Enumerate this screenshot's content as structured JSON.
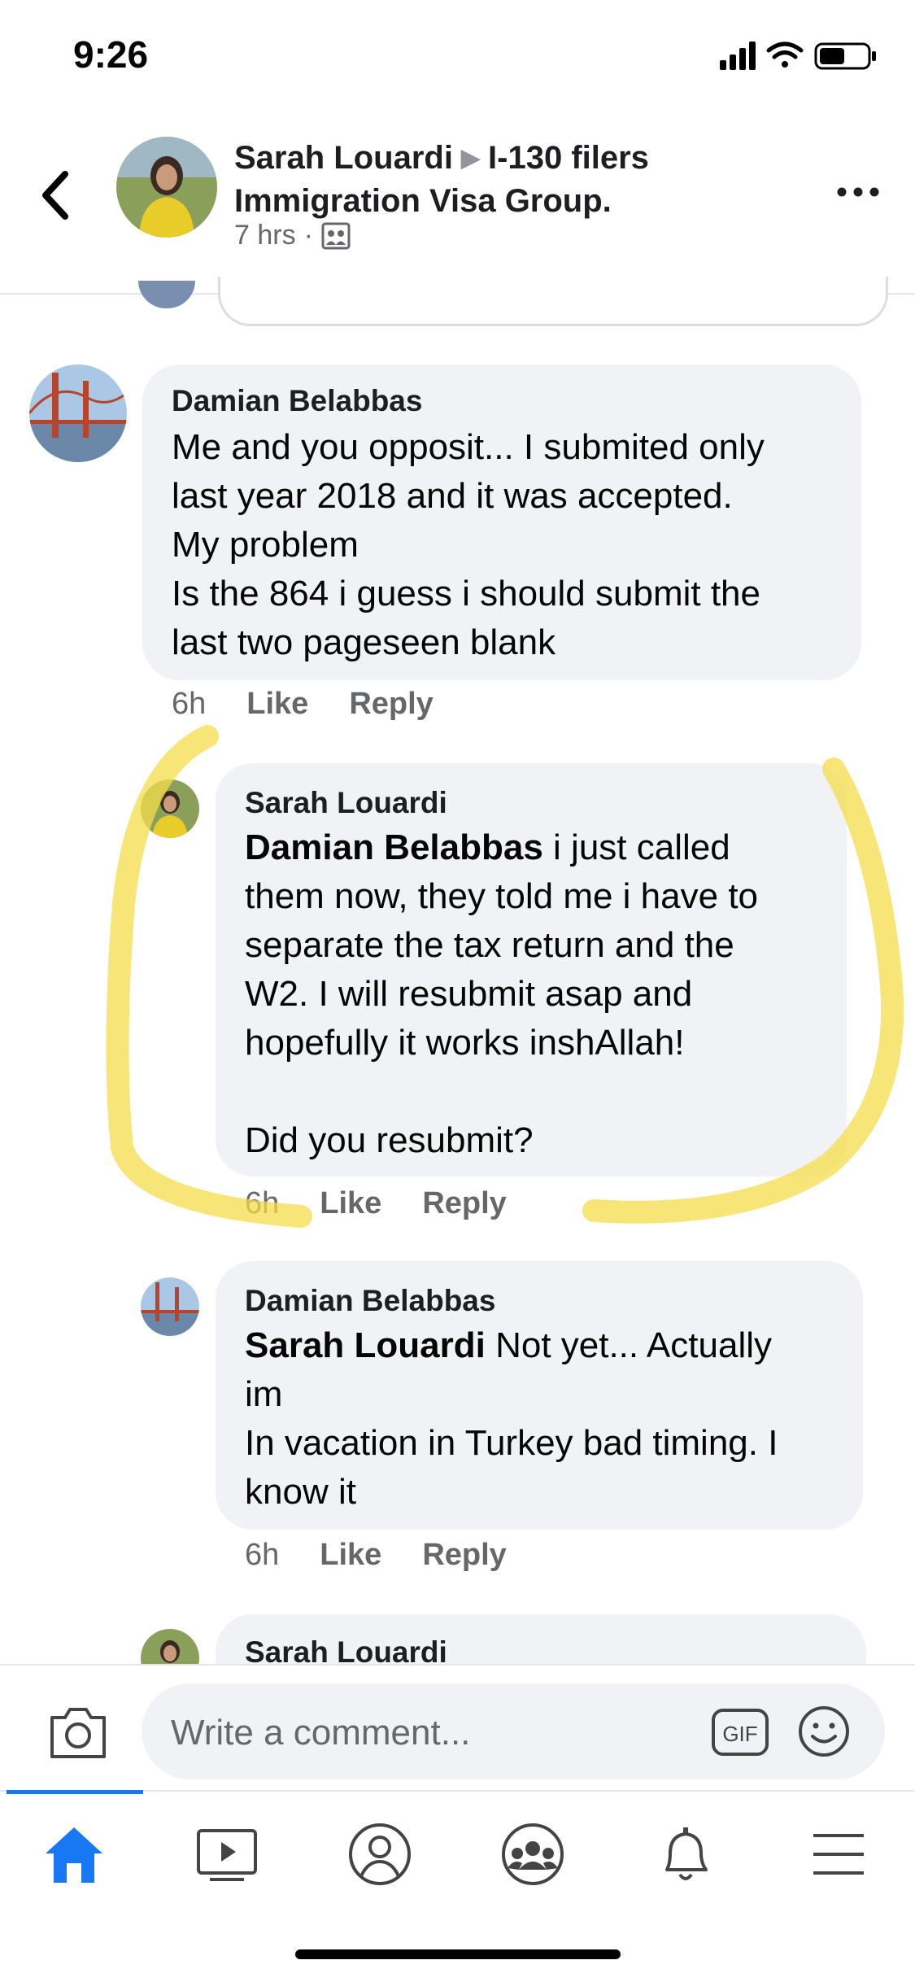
{
  "status_bar": {
    "time": "9:26"
  },
  "header": {
    "author": "Sarah Louardi",
    "group": "I-130 filers Immigration Visa Group.",
    "timestamp": "7 hrs",
    "separator": "·"
  },
  "comments": [
    {
      "author": "Damian Belabbas",
      "mention": "",
      "lines": "Me and you opposit... I submited only\nlast year 2018 and it was accepted.\nMy problem\nIs the 864 i guess i should submit the\nlast two pageseen blank",
      "time": "6h",
      "like": "Like",
      "reply": "Reply"
    },
    {
      "author": "Sarah Louardi",
      "mention": "Damian Belabbas",
      "lines": "  i just called\nthem now, they told me i have to\nseparate the tax return and the\nW2. I will resubmit asap and\nhopefully it works inshAllah!\n\nDid you resubmit?",
      "time": "6h",
      "like": "Like",
      "reply": "Reply"
    },
    {
      "author": "Damian Belabbas",
      "mention": "Sarah Louardi",
      "lines": " Not yet... Actually\nim\nIn vacation in Turkey bad timing. I\nknow it",
      "time": "6h",
      "like": "Like",
      "reply": "Reply"
    },
    {
      "author": "Sarah Louardi"
    }
  ],
  "comment_bar": {
    "placeholder": "Write a comment...",
    "gif_label": "GIF"
  },
  "nav": [
    "home-icon",
    "watch-icon",
    "profile-icon",
    "groups-icon",
    "notifications-icon",
    "menu-icon"
  ],
  "colors": {
    "accent": "#1877f2",
    "bubble": "#f0f2f5",
    "highlight": "#f6dc4a"
  }
}
